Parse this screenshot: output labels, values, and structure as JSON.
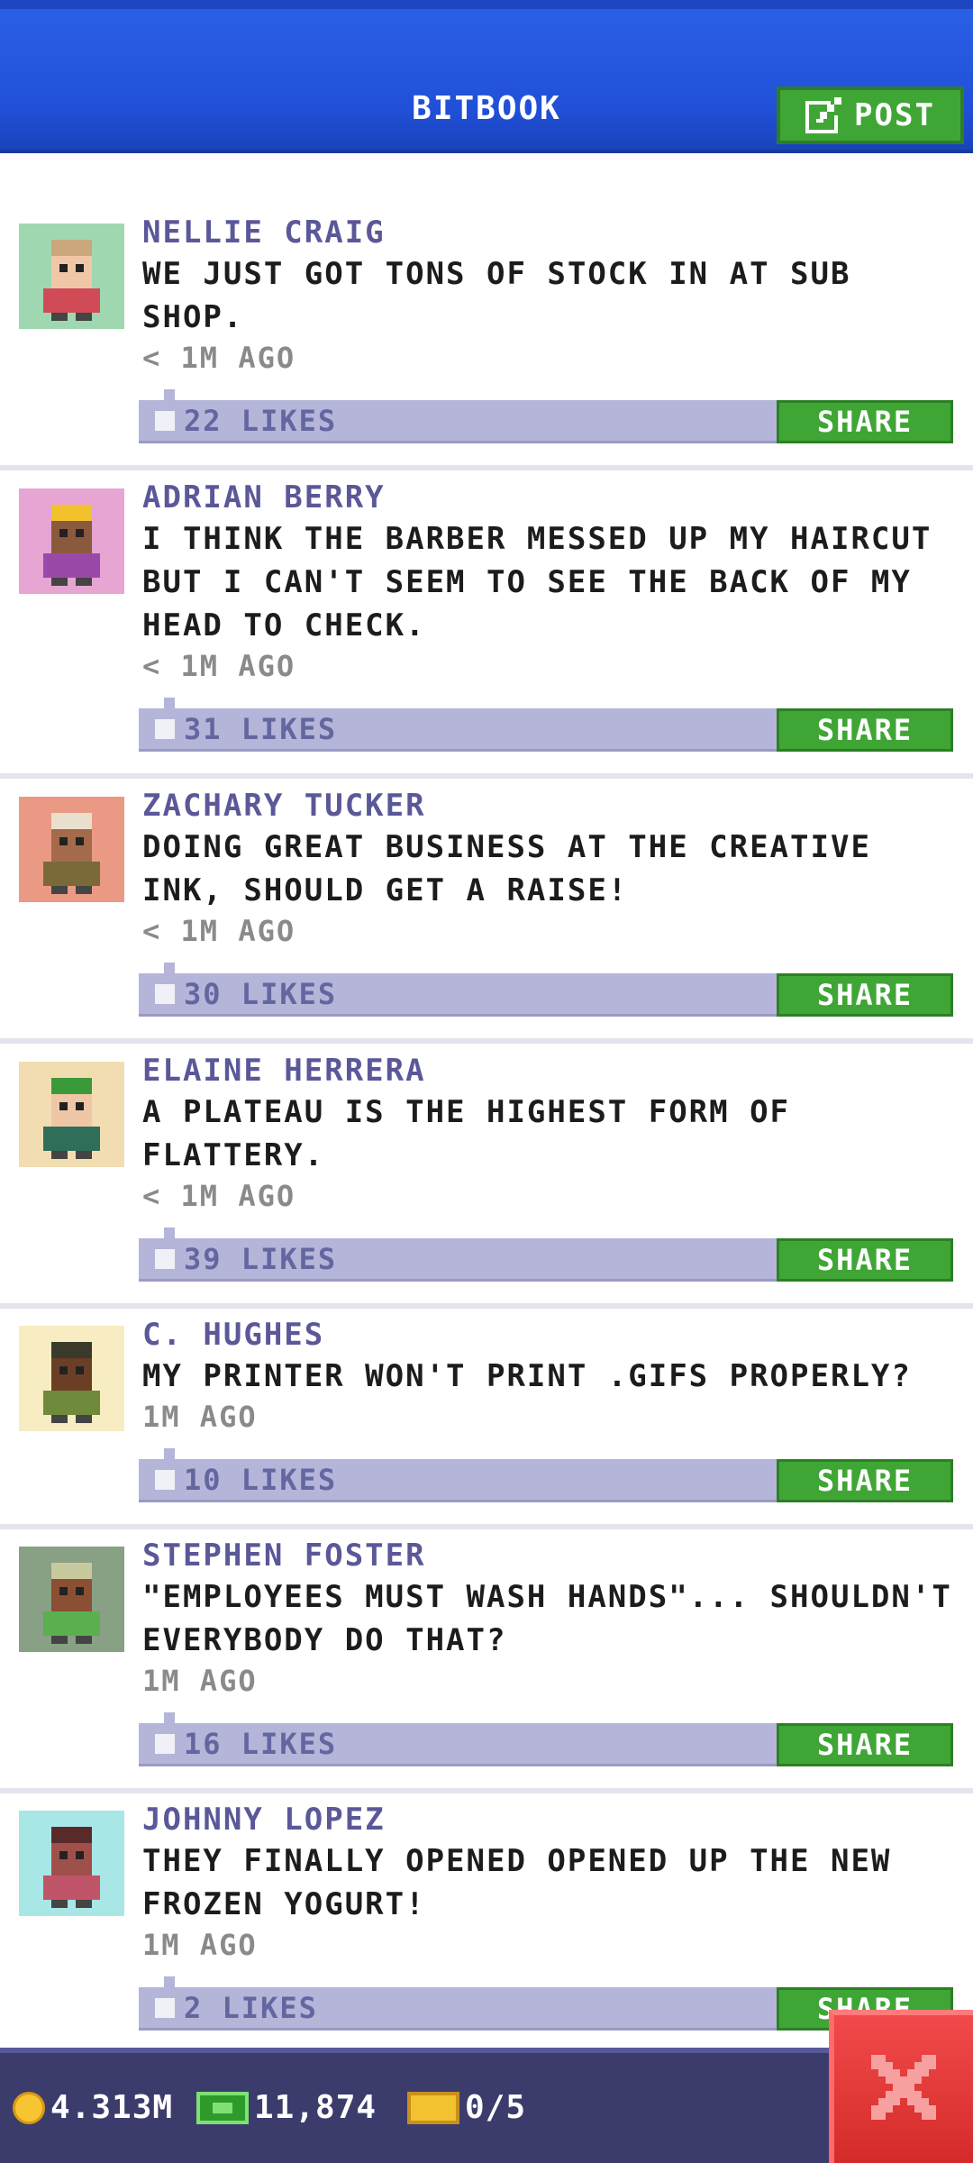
{
  "header": {
    "title": "BITBOOK",
    "post_label": "POST"
  },
  "posts": [
    {
      "name": "NELLIE CRAIG",
      "message": "WE JUST GOT TONS OF STOCK IN AT SUB SHOP.",
      "time": "< 1M AGO",
      "likes": "22 LIKES",
      "share": "SHARE",
      "avatar_bg": "#9fd8b0",
      "shirt": "#d14b57",
      "hair": "#caa77c",
      "skin": "#f0c7a6"
    },
    {
      "name": "ADRIAN BERRY",
      "message": "I THINK THE BARBER MESSED UP MY HAIRCUT BUT I CAN'T SEEM TO SEE THE BACK OF MY HEAD TO CHECK.",
      "time": "< 1M AGO",
      "likes": "31 LIKES",
      "share": "SHARE",
      "avatar_bg": "#e6a5d2",
      "shirt": "#9b49a8",
      "hair": "#f1c22c",
      "skin": "#8b5a3c"
    },
    {
      "name": "ZACHARY TUCKER",
      "message": "DOING GREAT BUSINESS AT THE CREATIVE INK, SHOULD GET A RAISE!",
      "time": "< 1M AGO",
      "likes": "30 LIKES",
      "share": "SHARE",
      "avatar_bg": "#ea9a84",
      "shirt": "#7a6a3a",
      "hair": "#e8e0cc",
      "skin": "#a46a4c"
    },
    {
      "name": "ELAINE HERRERA",
      "message": "A PLATEAU IS THE HIGHEST FORM OF FLATTERY.",
      "time": "< 1M AGO",
      "likes": "39 LIKES",
      "share": "SHARE",
      "avatar_bg": "#f2ddb2",
      "shirt": "#2f6f5a",
      "hair": "#3a9a3a",
      "skin": "#f0c7a6"
    },
    {
      "name": "C. HUGHES",
      "message": "MY PRINTER WON'T PRINT .GIFS PROPERLY?",
      "time": "1M AGO",
      "likes": "10 LIKES",
      "share": "SHARE",
      "avatar_bg": "#f7ecc2",
      "shirt": "#6f8a3a",
      "hair": "#3a3a2a",
      "skin": "#6b3f26"
    },
    {
      "name": "STEPHEN FOSTER",
      "message": "\"EMPLOYEES MUST WASH HANDS\"... SHOULDN'T EVERYBODY DO THAT?",
      "time": "1M AGO",
      "likes": "16 LIKES",
      "share": "SHARE",
      "avatar_bg": "#88a084",
      "shirt": "#5ab04e",
      "hair": "#c9c9a0",
      "skin": "#8b4f34"
    },
    {
      "name": "JOHNNY LOPEZ",
      "message": "THEY FINALLY OPENED OPENED UP THE NEW FROZEN YOGURT!",
      "time": "1M AGO",
      "likes": "2 LIKES",
      "share": "SHARE",
      "avatar_bg": "#a9e6e6",
      "shirt": "#c0556a",
      "hair": "#5a2a2a",
      "skin": "#a0504a"
    }
  ],
  "footer": {
    "coins": "4.313M",
    "bux": "11,874",
    "tickets": "0/5"
  },
  "colors": {
    "accent_blue": "#2150d8",
    "share_green": "#3fa636",
    "likes_bar": "#b4b5d8",
    "name_purple": "#5a5898",
    "close_red": "#e03a3a"
  },
  "icons": {
    "post": "edit-icon",
    "close": "close-icon",
    "coin": "coin-icon",
    "bux": "bux-icon",
    "ticket": "ticket-icon"
  }
}
